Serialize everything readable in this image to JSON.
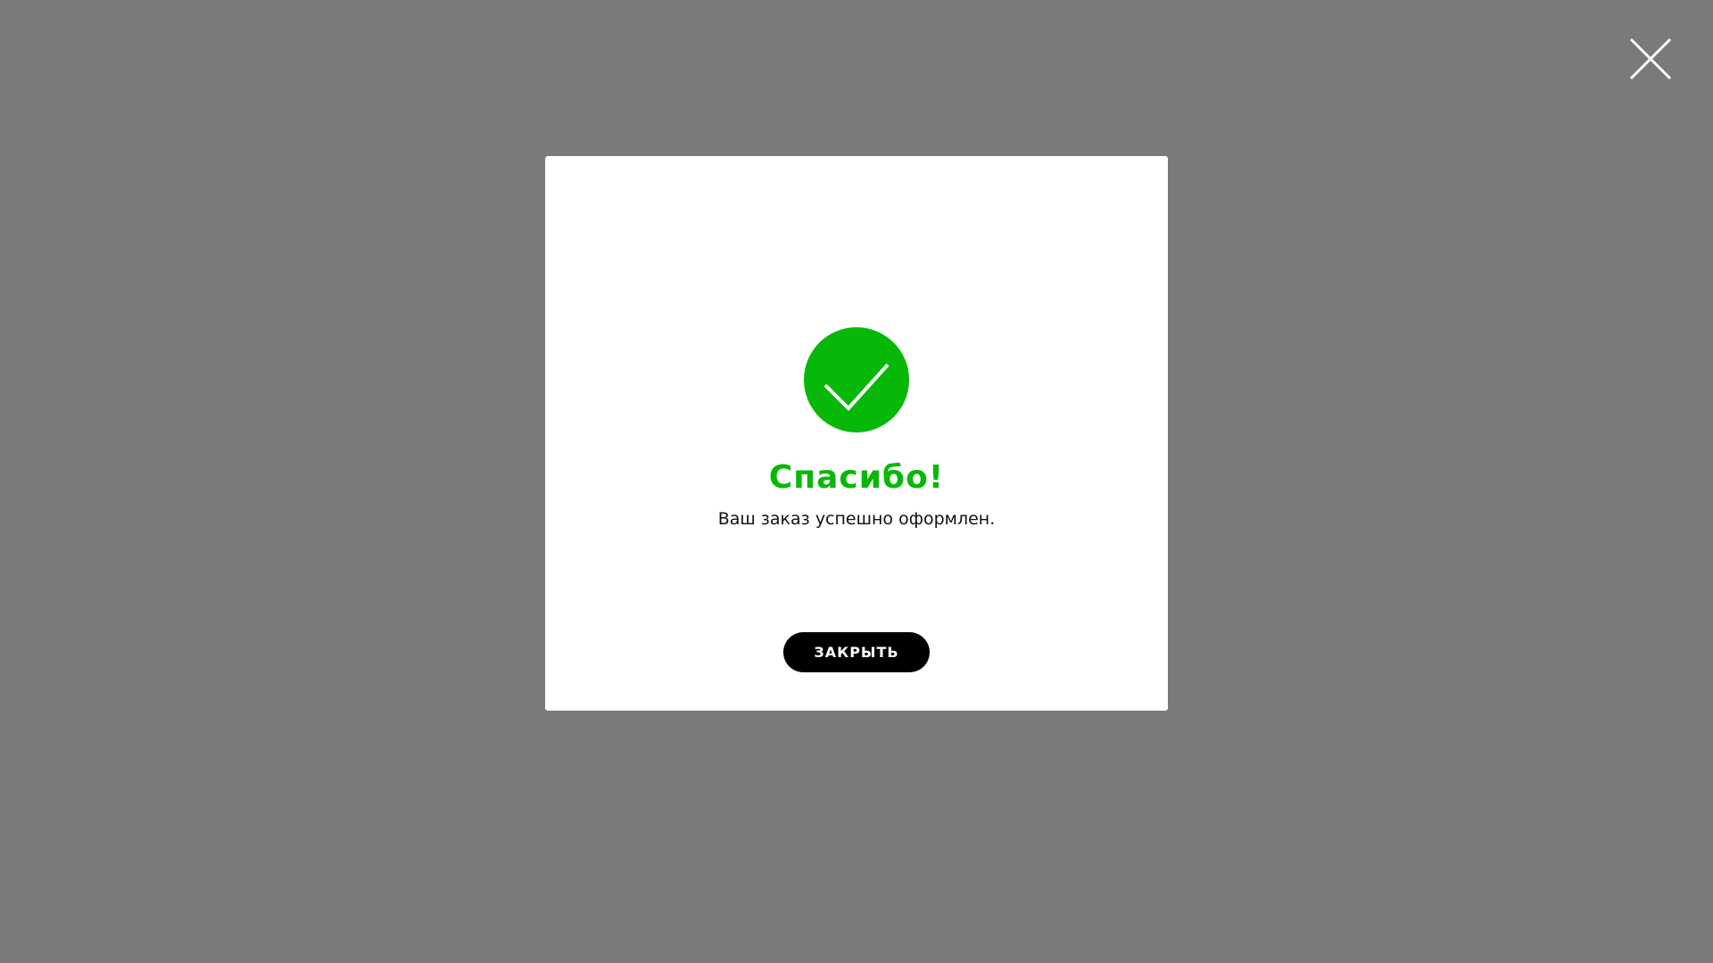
{
  "modal": {
    "title": "Спасибо!",
    "message": "Ваш заказ успешно оформлен.",
    "close_button_label": "ЗАКРЫТЬ",
    "success_icon": "check-circle-icon",
    "dismiss_icon": "close-icon"
  },
  "colors": {
    "overlay": "#7a7a7a",
    "accent_green": "#08b808",
    "button_bg": "#000000",
    "button_text": "#ffffff"
  }
}
